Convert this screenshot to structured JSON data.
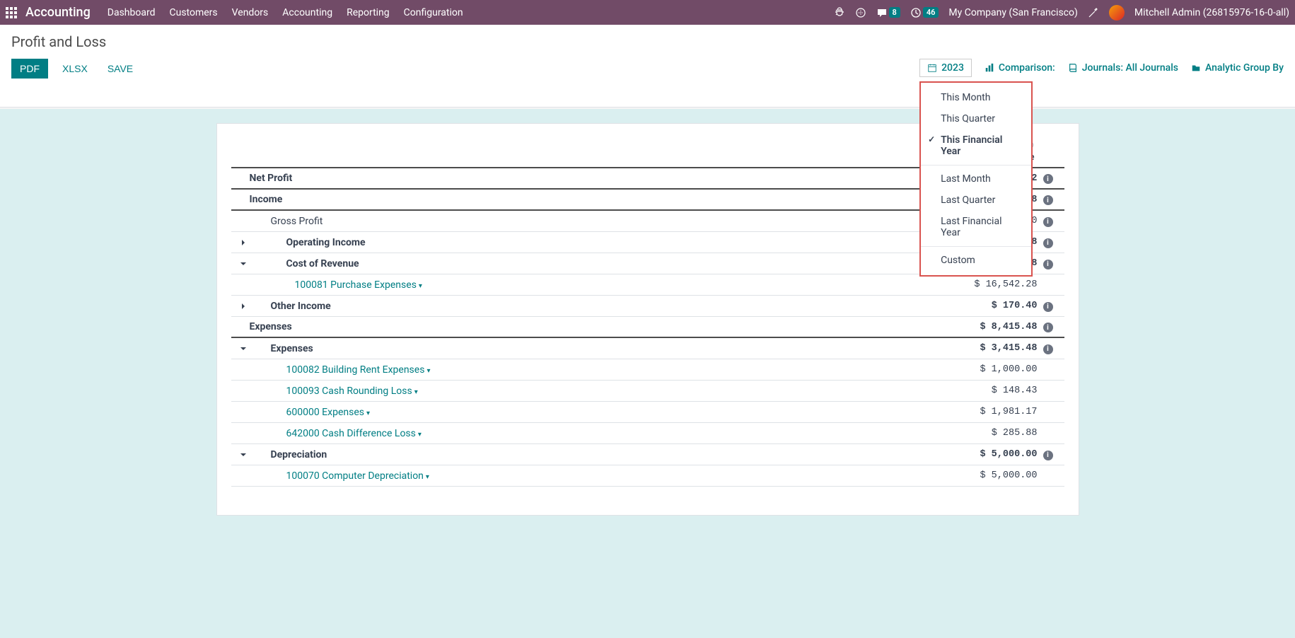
{
  "nav": {
    "app": "Accounting",
    "items": [
      "Dashboard",
      "Customers",
      "Vendors",
      "Accounting",
      "Reporting",
      "Configuration"
    ],
    "messages_badge": "8",
    "activities_badge": "46",
    "company": "My Company (San Francisco)",
    "user": "Mitchell Admin (26815976-16-0-all)"
  },
  "page": {
    "title": "Profit and Loss",
    "buttons": {
      "pdf": "PDF",
      "xlsx": "XLSX",
      "save": "SAVE"
    }
  },
  "filters": {
    "date_label": "2023",
    "comparison": "Comparison:",
    "journals": "Journals: All Journals",
    "analytic": "Analytic Group By",
    "options": "es Only , Accrual Basis"
  },
  "date_menu": {
    "items_top": [
      "This Month",
      "This Quarter",
      "This Financial Year"
    ],
    "items_mid": [
      "Last Month",
      "Last Quarter",
      "Last Financial Year"
    ],
    "items_bot": [
      "Custom"
    ],
    "selected": "This Financial Year"
  },
  "report": {
    "col_year": "2023",
    "col_balance": "Balance",
    "rows": [
      {
        "caret": "",
        "indent": 0,
        "label": "Net Profit",
        "value": "$ 108,852.32",
        "info": true,
        "bold": true,
        "thick": true
      },
      {
        "caret": "",
        "indent": 0,
        "label": "Income",
        "value": "$ 133,810.08",
        "info": true,
        "bold": true,
        "thick": true
      },
      {
        "caret": "",
        "indent": 1,
        "label": "Gross Profit",
        "value": "$ 117,097.40",
        "info": true
      },
      {
        "caret": "right",
        "indent": 2,
        "label": "Operating Income",
        "value": "$ 133,639.68",
        "info": true,
        "bold": true
      },
      {
        "caret": "down",
        "indent": 2,
        "label": "Cost of Revenue",
        "value": "$ 16,542.28",
        "info": true,
        "bold": true
      },
      {
        "caret": "",
        "indent": 3,
        "label": "100081 Purchase Expenses",
        "value": "$ 16,542.28",
        "info": false,
        "link": true
      },
      {
        "caret": "right",
        "indent": 1,
        "label": "Other Income",
        "value": "$ 170.40",
        "info": true,
        "bold": true
      },
      {
        "caret": "",
        "indent": 0,
        "label": "Expenses",
        "value": "$ 8,415.48",
        "info": true,
        "bold": true,
        "thick": true
      },
      {
        "caret": "down",
        "indent": 1,
        "label": "Expenses",
        "value": "$ 3,415.48",
        "info": true,
        "bold": true
      },
      {
        "caret": "",
        "indent": 2,
        "label": "100082 Building Rent Expenses",
        "value": "$ 1,000.00",
        "info": false,
        "link": true
      },
      {
        "caret": "",
        "indent": 2,
        "label": "100093 Cash Rounding Loss",
        "value": "$ 148.43",
        "info": false,
        "link": true
      },
      {
        "caret": "",
        "indent": 2,
        "label": "600000 Expenses",
        "value": "$ 1,981.17",
        "info": false,
        "link": true
      },
      {
        "caret": "",
        "indent": 2,
        "label": "642000 Cash Difference Loss",
        "value": "$ 285.88",
        "info": false,
        "link": true
      },
      {
        "caret": "down",
        "indent": 1,
        "label": "Depreciation",
        "value": "$ 5,000.00",
        "info": true,
        "bold": true
      },
      {
        "caret": "",
        "indent": 2,
        "label": "100070 Computer Depreciation",
        "value": "$ 5,000.00",
        "info": false,
        "link": true
      }
    ]
  }
}
